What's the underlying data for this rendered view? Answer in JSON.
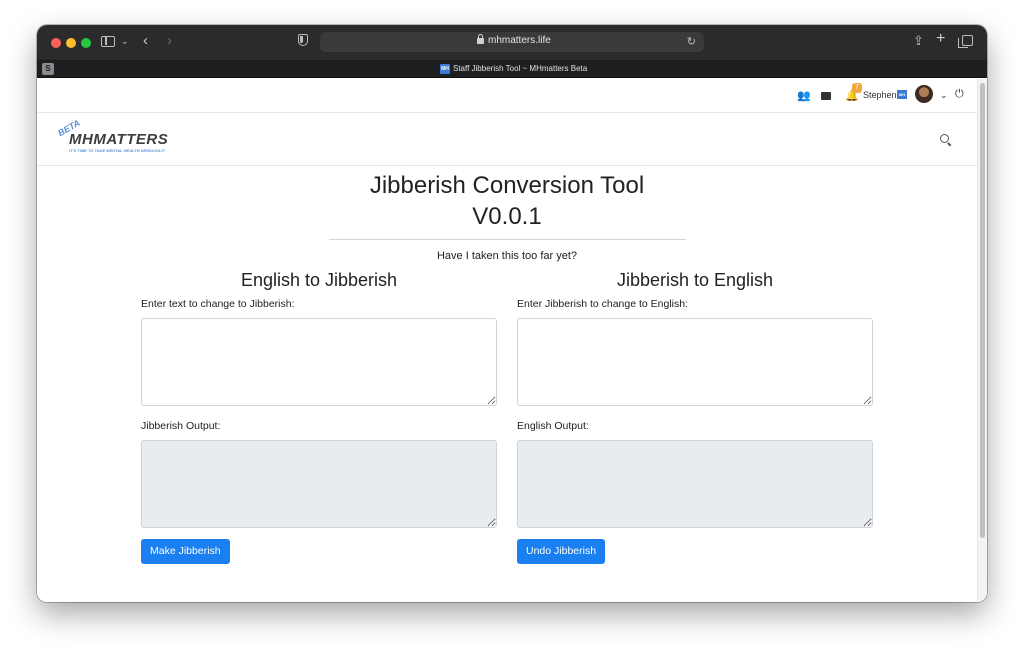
{
  "browser": {
    "url": "mhmatters.life",
    "pinned_tab_letter": "S",
    "tab_title": "Staff Jibberish Tool ~ MHmatters Beta",
    "tab_favicon_text": "MH"
  },
  "topbar": {
    "notification_count": "7",
    "username": "Stephen",
    "flag_text": "MH"
  },
  "brand": {
    "beta": "BETA",
    "name": "MHMATTERS",
    "tagline": "IT'S TIME TO TAKE MENTAL HEALTH SERIOUSLY!"
  },
  "main": {
    "title_line1": "Jibberish Conversion Tool",
    "title_line2": "V0.0.1",
    "tagline": "Have I taken this too far yet?",
    "left": {
      "heading": "English to Jibberish",
      "input_label": "Enter text to change to Jibberish:",
      "output_label": "Jibberish Output:",
      "button_label": "Make Jibberish"
    },
    "right": {
      "heading": "Jibberish to English",
      "input_label": "Enter Jibberish to change to English:",
      "output_label": "English Output:",
      "button_label": "Undo Jibberish"
    }
  },
  "colors": {
    "primary": "#1a7ff0",
    "badge": "#f0a73c",
    "toolbar": "#2b2b2d"
  }
}
